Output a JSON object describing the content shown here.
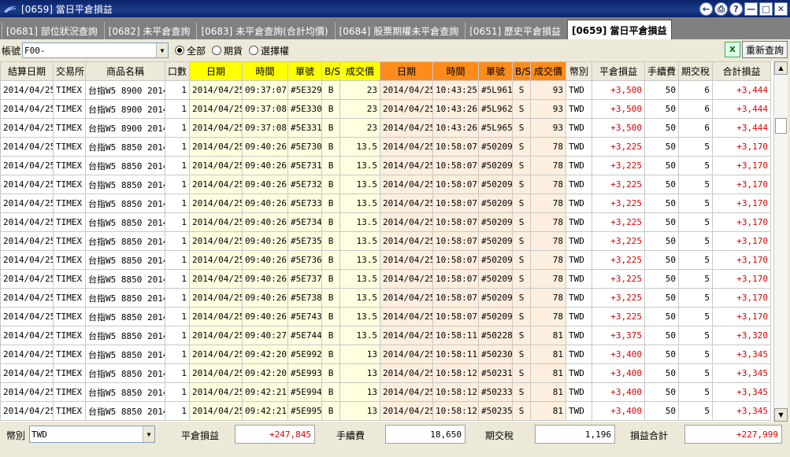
{
  "window": {
    "title": "[0659] 當日平倉損益",
    "buttons": {
      "back": "←",
      "print": "⎙",
      "help": "?",
      "minimize": "—",
      "maximize": "□",
      "close": "✕"
    }
  },
  "tabs": [
    {
      "label": "[0681] 部位狀況查詢",
      "active": false
    },
    {
      "label": "[0682] 未平倉查詢",
      "active": false
    },
    {
      "label": "[0683] 未平倉查詢(合計均價)",
      "active": false
    },
    {
      "label": "[0684] 股票期權未平倉查詢",
      "active": false
    },
    {
      "label": "[0651] 歷史平倉損益",
      "active": false
    },
    {
      "label": "[0659] 當日平倉損益",
      "active": true
    }
  ],
  "filter": {
    "account_label": "帳號",
    "account_value": "F00-",
    "radio_all": "全部",
    "radio_futures": "期貨",
    "radio_options": "選擇權",
    "selected": "all",
    "excel_icon": "excel-icon",
    "refresh_label": "重新查詢"
  },
  "table": {
    "headers": [
      "結算日期",
      "交易所",
      "商品名稱",
      "口數",
      "日期",
      "時間",
      "單號",
      "B/S",
      "成交價",
      "日期",
      "時間",
      "單號",
      "B/S",
      "成交價",
      "幣別",
      "平倉損益",
      "手續費",
      "期交稅",
      "合計損益"
    ],
    "header_colors": {
      "open": "#ffff00",
      "close": "#ff8c1a"
    },
    "rows": [
      [
        "2014/04/25",
        "TIMEX",
        "台指W5 8900 2014",
        "1",
        "2014/04/25",
        "09:37:07",
        "#5E329",
        "B",
        "23",
        "2014/04/25",
        "10:43:25",
        "#5L961",
        "S",
        "93",
        "TWD",
        "+3,500",
        "50",
        "6",
        "+3,444"
      ],
      [
        "2014/04/25",
        "TIMEX",
        "台指W5 8900 2014",
        "1",
        "2014/04/25",
        "09:37:08",
        "#5E330",
        "B",
        "23",
        "2014/04/25",
        "10:43:26",
        "#5L962",
        "S",
        "93",
        "TWD",
        "+3,500",
        "50",
        "6",
        "+3,444"
      ],
      [
        "2014/04/25",
        "TIMEX",
        "台指W5 8900 2014",
        "1",
        "2014/04/25",
        "09:37:08",
        "#5E331",
        "B",
        "23",
        "2014/04/25",
        "10:43:26",
        "#5L965",
        "S",
        "93",
        "TWD",
        "+3,500",
        "50",
        "6",
        "+3,444"
      ],
      [
        "2014/04/25",
        "TIMEX",
        "台指W5 8850 2014",
        "1",
        "2014/04/25",
        "09:40:26",
        "#5E730",
        "B",
        "13.5",
        "2014/04/25",
        "10:58:07",
        "#50209",
        "S",
        "78",
        "TWD",
        "+3,225",
        "50",
        "5",
        "+3,170"
      ],
      [
        "2014/04/25",
        "TIMEX",
        "台指W5 8850 2014",
        "1",
        "2014/04/25",
        "09:40:26",
        "#5E731",
        "B",
        "13.5",
        "2014/04/25",
        "10:58:07",
        "#50209",
        "S",
        "78",
        "TWD",
        "+3,225",
        "50",
        "5",
        "+3,170"
      ],
      [
        "2014/04/25",
        "TIMEX",
        "台指W5 8850 2014",
        "1",
        "2014/04/25",
        "09:40:26",
        "#5E732",
        "B",
        "13.5",
        "2014/04/25",
        "10:58:07",
        "#50209",
        "S",
        "78",
        "TWD",
        "+3,225",
        "50",
        "5",
        "+3,170"
      ],
      [
        "2014/04/25",
        "TIMEX",
        "台指W5 8850 2014",
        "1",
        "2014/04/25",
        "09:40:26",
        "#5E733",
        "B",
        "13.5",
        "2014/04/25",
        "10:58:07",
        "#50209",
        "S",
        "78",
        "TWD",
        "+3,225",
        "50",
        "5",
        "+3,170"
      ],
      [
        "2014/04/25",
        "TIMEX",
        "台指W5 8850 2014",
        "1",
        "2014/04/25",
        "09:40:26",
        "#5E734",
        "B",
        "13.5",
        "2014/04/25",
        "10:58:07",
        "#50209",
        "S",
        "78",
        "TWD",
        "+3,225",
        "50",
        "5",
        "+3,170"
      ],
      [
        "2014/04/25",
        "TIMEX",
        "台指W5 8850 2014",
        "1",
        "2014/04/25",
        "09:40:26",
        "#5E735",
        "B",
        "13.5",
        "2014/04/25",
        "10:58:07",
        "#50209",
        "S",
        "78",
        "TWD",
        "+3,225",
        "50",
        "5",
        "+3,170"
      ],
      [
        "2014/04/25",
        "TIMEX",
        "台指W5 8850 2014",
        "1",
        "2014/04/25",
        "09:40:26",
        "#5E736",
        "B",
        "13.5",
        "2014/04/25",
        "10:58:07",
        "#50209",
        "S",
        "78",
        "TWD",
        "+3,225",
        "50",
        "5",
        "+3,170"
      ],
      [
        "2014/04/25",
        "TIMEX",
        "台指W5 8850 2014",
        "1",
        "2014/04/25",
        "09:40:26",
        "#5E737",
        "B",
        "13.5",
        "2014/04/25",
        "10:58:07",
        "#50209",
        "S",
        "78",
        "TWD",
        "+3,225",
        "50",
        "5",
        "+3,170"
      ],
      [
        "2014/04/25",
        "TIMEX",
        "台指W5 8850 2014",
        "1",
        "2014/04/25",
        "09:40:26",
        "#5E738",
        "B",
        "13.5",
        "2014/04/25",
        "10:58:07",
        "#50209",
        "S",
        "78",
        "TWD",
        "+3,225",
        "50",
        "5",
        "+3,170"
      ],
      [
        "2014/04/25",
        "TIMEX",
        "台指W5 8850 2014",
        "1",
        "2014/04/25",
        "09:40:26",
        "#5E743",
        "B",
        "13.5",
        "2014/04/25",
        "10:58:07",
        "#50209",
        "S",
        "78",
        "TWD",
        "+3,225",
        "50",
        "5",
        "+3,170"
      ],
      [
        "2014/04/25",
        "TIMEX",
        "台指W5 8850 2014",
        "1",
        "2014/04/25",
        "09:40:27",
        "#5E744",
        "B",
        "13.5",
        "2014/04/25",
        "10:58:11",
        "#50228",
        "S",
        "81",
        "TWD",
        "+3,375",
        "50",
        "5",
        "+3,320"
      ],
      [
        "2014/04/25",
        "TIMEX",
        "台指W5 8850 2014",
        "1",
        "2014/04/25",
        "09:42:20",
        "#5E992",
        "B",
        "13",
        "2014/04/25",
        "10:58:11",
        "#50230",
        "S",
        "81",
        "TWD",
        "+3,400",
        "50",
        "5",
        "+3,345"
      ],
      [
        "2014/04/25",
        "TIMEX",
        "台指W5 8850 2014",
        "1",
        "2014/04/25",
        "09:42:20",
        "#5E993",
        "B",
        "13",
        "2014/04/25",
        "10:58:12",
        "#50231",
        "S",
        "81",
        "TWD",
        "+3,400",
        "50",
        "5",
        "+3,345"
      ],
      [
        "2014/04/25",
        "TIMEX",
        "台指W5 8850 2014",
        "1",
        "2014/04/25",
        "09:42:21",
        "#5E994",
        "B",
        "13",
        "2014/04/25",
        "10:58:12",
        "#50233",
        "S",
        "81",
        "TWD",
        "+3,400",
        "50",
        "5",
        "+3,345"
      ],
      [
        "2014/04/25",
        "TIMEX",
        "台指W5 8850 2014",
        "1",
        "2014/04/25",
        "09:42:21",
        "#5E995",
        "B",
        "13",
        "2014/04/25",
        "10:58:12",
        "#50235",
        "S",
        "81",
        "TWD",
        "+3,400",
        "50",
        "5",
        "+3,345"
      ]
    ]
  },
  "footer": {
    "currency_label": "幣別",
    "currency_value": "TWD",
    "pnl_label": "平倉損益",
    "pnl_value": "+247,845",
    "fee_label": "手續費",
    "fee_value": "18,650",
    "tax_label": "期交稅",
    "tax_value": "1,196",
    "total_label": "損益合計",
    "total_value": "+227,999"
  },
  "colors": {
    "profit": "#e00000",
    "open_header": "#ffff00",
    "close_header": "#ff8c1a",
    "titlebar": "#0a246a"
  }
}
